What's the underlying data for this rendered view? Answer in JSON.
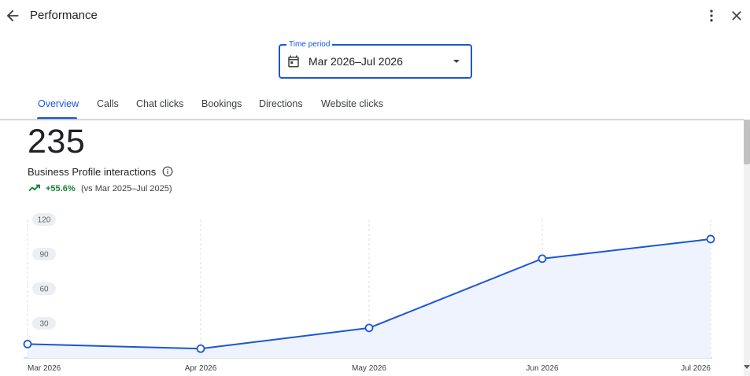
{
  "header": {
    "title": "Performance"
  },
  "time_period": {
    "label": "Time period",
    "value": "Mar 2026–Jul 2026"
  },
  "tabs": [
    {
      "label": "Overview",
      "active": true
    },
    {
      "label": "Calls",
      "active": false
    },
    {
      "label": "Chat clicks",
      "active": false
    },
    {
      "label": "Bookings",
      "active": false
    },
    {
      "label": "Directions",
      "active": false
    },
    {
      "label": "Website clicks",
      "active": false
    }
  ],
  "summary": {
    "total": "235",
    "metric_label": "Business Profile interactions",
    "change": "+55.6%",
    "comparison": "(vs Mar 2025–Jul 2025)"
  },
  "colors": {
    "accent": "#1a56d6",
    "positive": "#188038",
    "area_fill": "#eef3fd"
  },
  "icons": {
    "back": "arrow-left-icon",
    "more": "more-vert-icon",
    "close": "close-icon",
    "calendar": "calendar-icon",
    "dropdown": "arrow-drop-down-icon",
    "info": "info-icon",
    "trend": "trending-up-icon"
  },
  "chart_data": {
    "type": "area",
    "categories": [
      "Mar 2026",
      "Apr 2026",
      "May 2026",
      "Jun 2026",
      "Jul 2026"
    ],
    "values": [
      12,
      8,
      26,
      86,
      103
    ],
    "yticks": [
      "120",
      "90",
      "60",
      "30"
    ],
    "ylim": [
      0,
      120
    ],
    "grid": "vertical dashed",
    "title": "",
    "xlabel": "",
    "ylabel": ""
  }
}
